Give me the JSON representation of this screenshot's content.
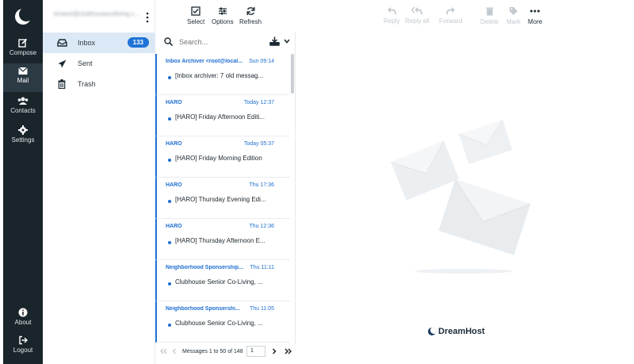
{
  "rail": {
    "compose": "Compose",
    "mail": "Mail",
    "contacts": "Contacts",
    "settings": "Settings",
    "about": "About",
    "logout": "Logout"
  },
  "account": {
    "email": "kmarel@clubhousecoliving.c..."
  },
  "folders": [
    {
      "label": "Inbox",
      "count": "133"
    },
    {
      "label": "Sent"
    },
    {
      "label": "Trash"
    }
  ],
  "list_toolbar": {
    "select": "Select",
    "options": "Options",
    "refresh": "Refresh"
  },
  "msg_toolbar": {
    "reply": "Reply",
    "reply_all": "Reply all",
    "forward": "Forward",
    "delete": "Delete",
    "mark": "Mark",
    "more": "More"
  },
  "search": {
    "placeholder": "Search..."
  },
  "messages": [
    {
      "from": "Inbox Archiver <root@local...",
      "time": "Sun 09:14",
      "subject": "[Inbox archiver: 7 old messag..."
    },
    {
      "from": "HARO",
      "time": "Today 12:37",
      "subject": "[HARO] Friday Afternoon Editi..."
    },
    {
      "from": "HARO",
      "time": "Today 05:37",
      "subject": "[HARO] Friday Morning Edition"
    },
    {
      "from": "HARO",
      "time": "Thu 17:36",
      "subject": "[HARO] Thursday Evening Edi..."
    },
    {
      "from": "HARO",
      "time": "Thu 12:36",
      "subject": "[HARO] Thursday Afternoon E..."
    },
    {
      "from": "Neighborhood Sponsership...",
      "time": "Thu 11:11",
      "subject": "Clubhouse Senior Co-Living, ..."
    },
    {
      "from": "Neighborhood Sponsershi...",
      "time": "Thu 11:05",
      "subject": "Clubhouse Senior Co-Living, ..."
    }
  ],
  "pager": {
    "text": "Messages 1 to 50 of 148",
    "page": "1"
  },
  "brand": {
    "name": "DreamHost"
  },
  "colors": {
    "accent": "#1f73d7",
    "rail": "#19242b",
    "selected_folder": "#dbe8f5"
  }
}
